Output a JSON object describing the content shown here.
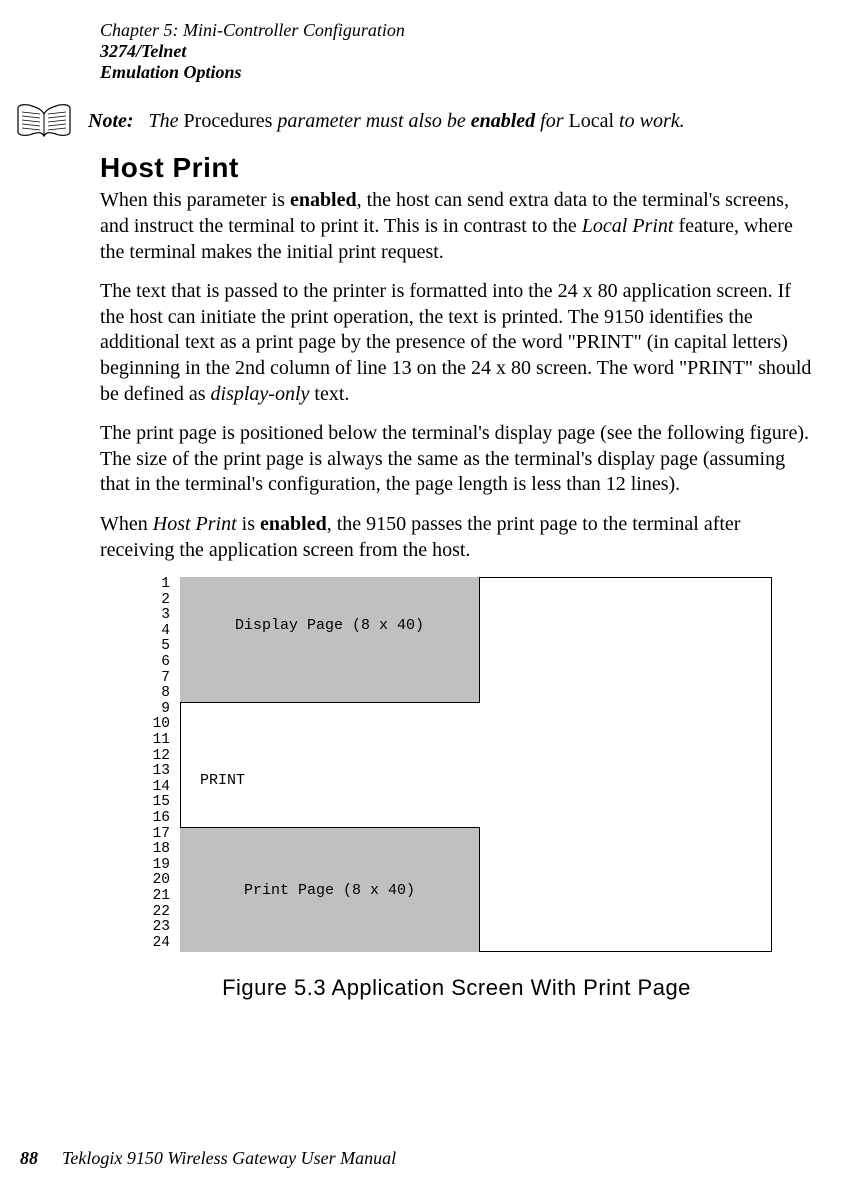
{
  "header": {
    "chapter": "Chapter 5:  Mini-Controller Configuration",
    "section_l1": "3274/Telnet",
    "section_l2": "Emulation Options"
  },
  "note": {
    "label": "Note:",
    "t1": "The ",
    "roman1": "Procedures",
    "t2": " parameter must also be ",
    "bold1": "enabled",
    "t3": " for ",
    "roman2": "Local",
    "t4": " to work."
  },
  "heading_hostprint": "Host Print",
  "para1": {
    "a": "When this parameter is ",
    "b": "enabled",
    "c": ", the host can send extra data to the terminal's screens, and instruct the terminal to print it. This is in contrast to the ",
    "d": "Local Print",
    "e": " feature, where the terminal makes the initial print request."
  },
  "para2": {
    "a": "The text that is passed to the printer is formatted into the 24 x 80 application screen. If the host can initiate the print operation, the text is printed. The 9150 identifies the additional text as a print page by the presence of the word \"PRINT\" (in capital letters) beginning in the 2nd column of line 13 on the 24 x 80 screen. The word \"PRINT\" should be defined as ",
    "b": "display-only",
    "c": " text."
  },
  "para3": "The print page is positioned below the terminal's display page (see the following figure). The size of the print page is always the same as the terminal's display page (assuming that in the terminal's configuration, the page length is less than 12 lines).",
  "para4": {
    "a": "When ",
    "b": "Host Print",
    "c": " is ",
    "d": "enabled",
    "e": ", the 9150 passes the print page to the terminal after receiving the application screen from the host."
  },
  "figure": {
    "rows": [
      " 1",
      " 2",
      " 3",
      " 4",
      " 5",
      " 6",
      " 7",
      " 8",
      " 9",
      "10",
      "11",
      "12",
      "13",
      "14",
      "15",
      "16",
      "17",
      "18",
      "19",
      "20",
      "21",
      "22",
      "23",
      "24"
    ],
    "display_label": "Display Page (8 x 40)",
    "print_word": " PRINT",
    "print_label": "Print Page (8 x 40)",
    "caption": "Figure 5.3 Application Screen With Print Page"
  },
  "footer": {
    "page": "88",
    "title": "Teklogix 9150 Wireless Gateway User Manual"
  }
}
